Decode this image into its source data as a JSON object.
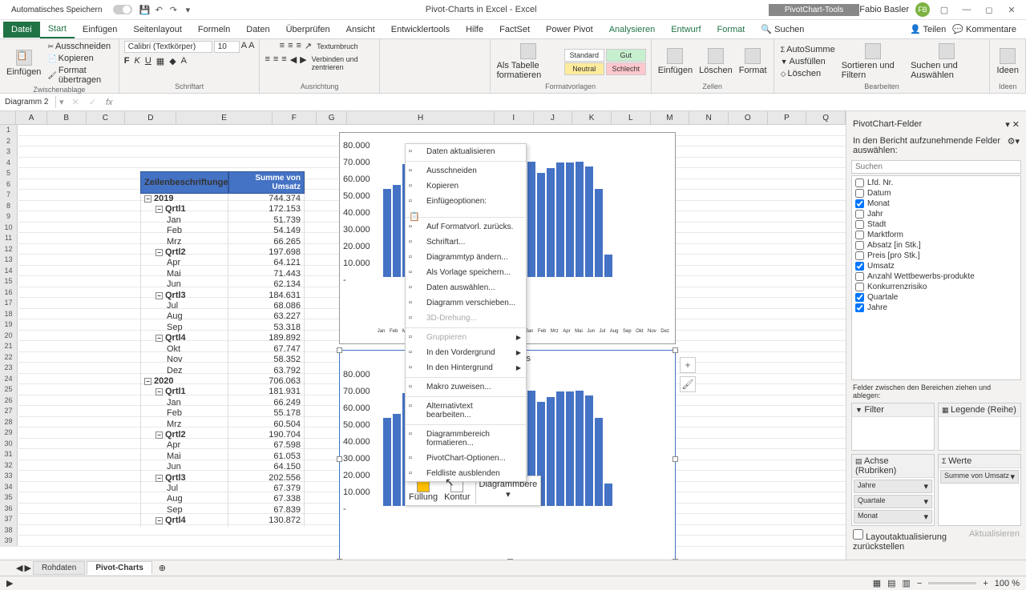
{
  "titlebar": {
    "autosave": "Automatisches Speichern",
    "title": "Pivot-Charts in Excel - Excel",
    "tools": "PivotChart-Tools",
    "user": "Fabio Basler",
    "user_initials": "FB"
  },
  "tabs": {
    "file": "Datei",
    "start": "Start",
    "insert": "Einfügen",
    "layout": "Seitenlayout",
    "formulas": "Formeln",
    "data": "Daten",
    "review": "Überprüfen",
    "view": "Ansicht",
    "dev": "Entwicklertools",
    "help": "Hilfe",
    "factset": "FactSet",
    "powerpivot": "Power Pivot",
    "analyze": "Analysieren",
    "design": "Entwurf",
    "format": "Format",
    "search": "Suchen",
    "share": "Teilen",
    "comments": "Kommentare"
  },
  "ribbon": {
    "paste": "Einfügen",
    "cut": "Ausschneiden",
    "copy": "Kopieren",
    "format_painter": "Format übertragen",
    "clipboard": "Zwischenablage",
    "font": "Schriftart",
    "font_name": "Calibri (Textkörper)",
    "font_size": "10",
    "alignment": "Ausrichtung",
    "wrap": "Textumbruch",
    "merge": "Verbinden und zentrieren",
    "styles": "Formatvorlagen",
    "std": "Standard",
    "good": "Gut",
    "neutral": "Neutral",
    "bad": "Schlecht",
    "table": "Als Tabelle formatieren",
    "cells": "Zellen",
    "insert_c": "Einfügen",
    "delete": "Löschen",
    "format_c": "Format",
    "sum": "AutoSumme",
    "fill": "Ausfüllen",
    "clear": "Löschen",
    "sort": "Sortieren und Filtern",
    "find": "Suchen und Auswählen",
    "editing": "Bearbeiten",
    "ideas": "Ideen"
  },
  "namebox": {
    "cell": "Diagramm 2"
  },
  "cols": [
    "A",
    "B",
    "C",
    "D",
    "E",
    "F",
    "G",
    "H",
    "I",
    "J",
    "K",
    "L",
    "M",
    "N",
    "O",
    "P",
    "Q"
  ],
  "pivot": {
    "h1": "Zeilenbeschriftungen",
    "h2": "Summe von Umsatz",
    "rows": [
      {
        "l": "2019",
        "v": "744.374",
        "t": "year"
      },
      {
        "l": "Qrtl1",
        "v": "172.153",
        "t": "q"
      },
      {
        "l": "Jan",
        "v": "51.739",
        "t": "m"
      },
      {
        "l": "Feb",
        "v": "54.149",
        "t": "m"
      },
      {
        "l": "Mrz",
        "v": "66.265",
        "t": "m"
      },
      {
        "l": "Qrtl2",
        "v": "197.698",
        "t": "q"
      },
      {
        "l": "Apr",
        "v": "64.121",
        "t": "m"
      },
      {
        "l": "Mai",
        "v": "71.443",
        "t": "m"
      },
      {
        "l": "Jun",
        "v": "62.134",
        "t": "m"
      },
      {
        "l": "Qrtl3",
        "v": "184.631",
        "t": "q"
      },
      {
        "l": "Jul",
        "v": "68.086",
        "t": "m"
      },
      {
        "l": "Aug",
        "v": "63.227",
        "t": "m"
      },
      {
        "l": "Sep",
        "v": "53.318",
        "t": "m"
      },
      {
        "l": "Qrtl4",
        "v": "189.892",
        "t": "q"
      },
      {
        "l": "Okt",
        "v": "67.747",
        "t": "m"
      },
      {
        "l": "Nov",
        "v": "58.352",
        "t": "m"
      },
      {
        "l": "Dez",
        "v": "63.792",
        "t": "m"
      },
      {
        "l": "2020",
        "v": "706.063",
        "t": "year"
      },
      {
        "l": "Qrtl1",
        "v": "181.931",
        "t": "q"
      },
      {
        "l": "Jan",
        "v": "66.249",
        "t": "m"
      },
      {
        "l": "Feb",
        "v": "55.178",
        "t": "m"
      },
      {
        "l": "Mrz",
        "v": "60.504",
        "t": "m"
      },
      {
        "l": "Qrtl2",
        "v": "190.704",
        "t": "q"
      },
      {
        "l": "Apr",
        "v": "67.598",
        "t": "m"
      },
      {
        "l": "Mai",
        "v": "61.053",
        "t": "m"
      },
      {
        "l": "Jun",
        "v": "64.150",
        "t": "m"
      },
      {
        "l": "Qrtl3",
        "v": "202.556",
        "t": "q"
      },
      {
        "l": "Jul",
        "v": "67.379",
        "t": "m"
      },
      {
        "l": "Aug",
        "v": "67.338",
        "t": "m"
      },
      {
        "l": "Sep",
        "v": "67.839",
        "t": "m"
      },
      {
        "l": "Qrtl4",
        "v": "130.872",
        "t": "q"
      }
    ]
  },
  "context_menu": {
    "items": [
      {
        "l": "Daten aktualisieren"
      },
      {
        "sep": true
      },
      {
        "l": "Ausschneiden"
      },
      {
        "l": "Kopieren"
      },
      {
        "l": "Einfügeoptionen:",
        "bold": true
      },
      {
        "paste": true
      },
      {
        "sep": true
      },
      {
        "l": "Auf Formatvorl. zurücks."
      },
      {
        "l": "Schriftart..."
      },
      {
        "l": "Diagrammtyp ändern..."
      },
      {
        "l": "Als Vorlage speichern..."
      },
      {
        "l": "Daten auswählen..."
      },
      {
        "l": "Diagramm verschieben..."
      },
      {
        "l": "3D-Drehung...",
        "disabled": true
      },
      {
        "sep": true
      },
      {
        "l": "Gruppieren",
        "disabled": true,
        "arrow": true
      },
      {
        "l": "In den Vordergrund",
        "arrow": true
      },
      {
        "l": "In den Hintergrund",
        "arrow": true
      },
      {
        "sep": true
      },
      {
        "l": "Makro zuweisen..."
      },
      {
        "sep": true
      },
      {
        "l": "Alternativtext bearbeiten..."
      },
      {
        "sep": true
      },
      {
        "l": "Diagrammbereich formatieren..."
      },
      {
        "l": "PivotChart-Optionen..."
      },
      {
        "l": "Feldliste ausblenden"
      }
    ]
  },
  "format_bar": {
    "fill": "Füllung",
    "outline": "Kontur",
    "area": "Diagrammbere"
  },
  "chart_data": {
    "type": "bar",
    "title": "Ergebnis",
    "ylabel": "",
    "xlabel": "",
    "ylim": [
      0,
      80000
    ],
    "yticks": [
      "80.000",
      "70.000",
      "60.000",
      "50.000",
      "40.000",
      "30.000",
      "20.000",
      "10.000",
      "-"
    ],
    "categories": [
      "Jan",
      "Feb",
      "Mrz",
      "Apr",
      "Mai",
      "Jun",
      "Jul",
      "Aug",
      "Sep",
      "Okt",
      "Nov",
      "Dez",
      "Jan",
      "Feb",
      "Mrz",
      "Apr",
      "Mai",
      "Jun",
      "Jul",
      "Aug",
      "Sep",
      "Okt",
      "Nov",
      "Dez"
    ],
    "quarters": [
      "Qrtl1",
      "Qrtl2",
      "Qrtl3",
      "Qrtl4",
      "Qrtl1",
      "Qrtl2",
      "Qrtl3",
      "Qrtl4"
    ],
    "years": [
      "2019",
      "2020"
    ],
    "series": [
      {
        "name": "Summe von Umsatz",
        "values": [
          51739,
          54149,
          66265,
          64121,
          71443,
          62134,
          68086,
          63227,
          53318,
          67747,
          58352,
          63792,
          66249,
          55178,
          60504,
          67598,
          61053,
          64150,
          67379,
          67338,
          67839,
          65000,
          52000,
          13000
        ]
      }
    ]
  },
  "sidepanel": {
    "title": "PivotChart-Felder",
    "sub": "In den Bericht aufzunehmende Felder auswählen:",
    "search": "Suchen",
    "fields": [
      {
        "l": "Lfd. Nr.",
        "c": false
      },
      {
        "l": "Datum",
        "c": false
      },
      {
        "l": "Monat",
        "c": true
      },
      {
        "l": "Jahr",
        "c": false
      },
      {
        "l": "Stadt",
        "c": false
      },
      {
        "l": "Marktform",
        "c": false
      },
      {
        "l": "Absatz [in Stk.]",
        "c": false
      },
      {
        "l": "Preis [pro Stk.]",
        "c": false
      },
      {
        "l": "Umsatz",
        "c": true
      },
      {
        "l": "Anzahl Wettbewerbs-produkte",
        "c": false
      },
      {
        "l": "Konkurrenzrisiko",
        "c": false
      },
      {
        "l": "Quartale",
        "c": true
      },
      {
        "l": "Jahre",
        "c": true
      }
    ],
    "drag": "Felder zwischen den Bereichen ziehen und ablegen:",
    "filter": "Filter",
    "legend": "Legende (Reihe)",
    "axis": "Achse (Rubriken)",
    "values": "Werte",
    "axis_items": [
      "Jahre",
      "Quartale",
      "Monat"
    ],
    "value_items": [
      "Summe von Umsatz"
    ],
    "defer": "Layoutaktualisierung zurückstellen",
    "update": "Aktualisieren"
  },
  "sheets": {
    "raw": "Rohdaten",
    "pivot": "Pivot-Charts"
  },
  "status": {
    "zoom": "100 %",
    "chart_label": "bnis",
    "year2020": "2020"
  }
}
